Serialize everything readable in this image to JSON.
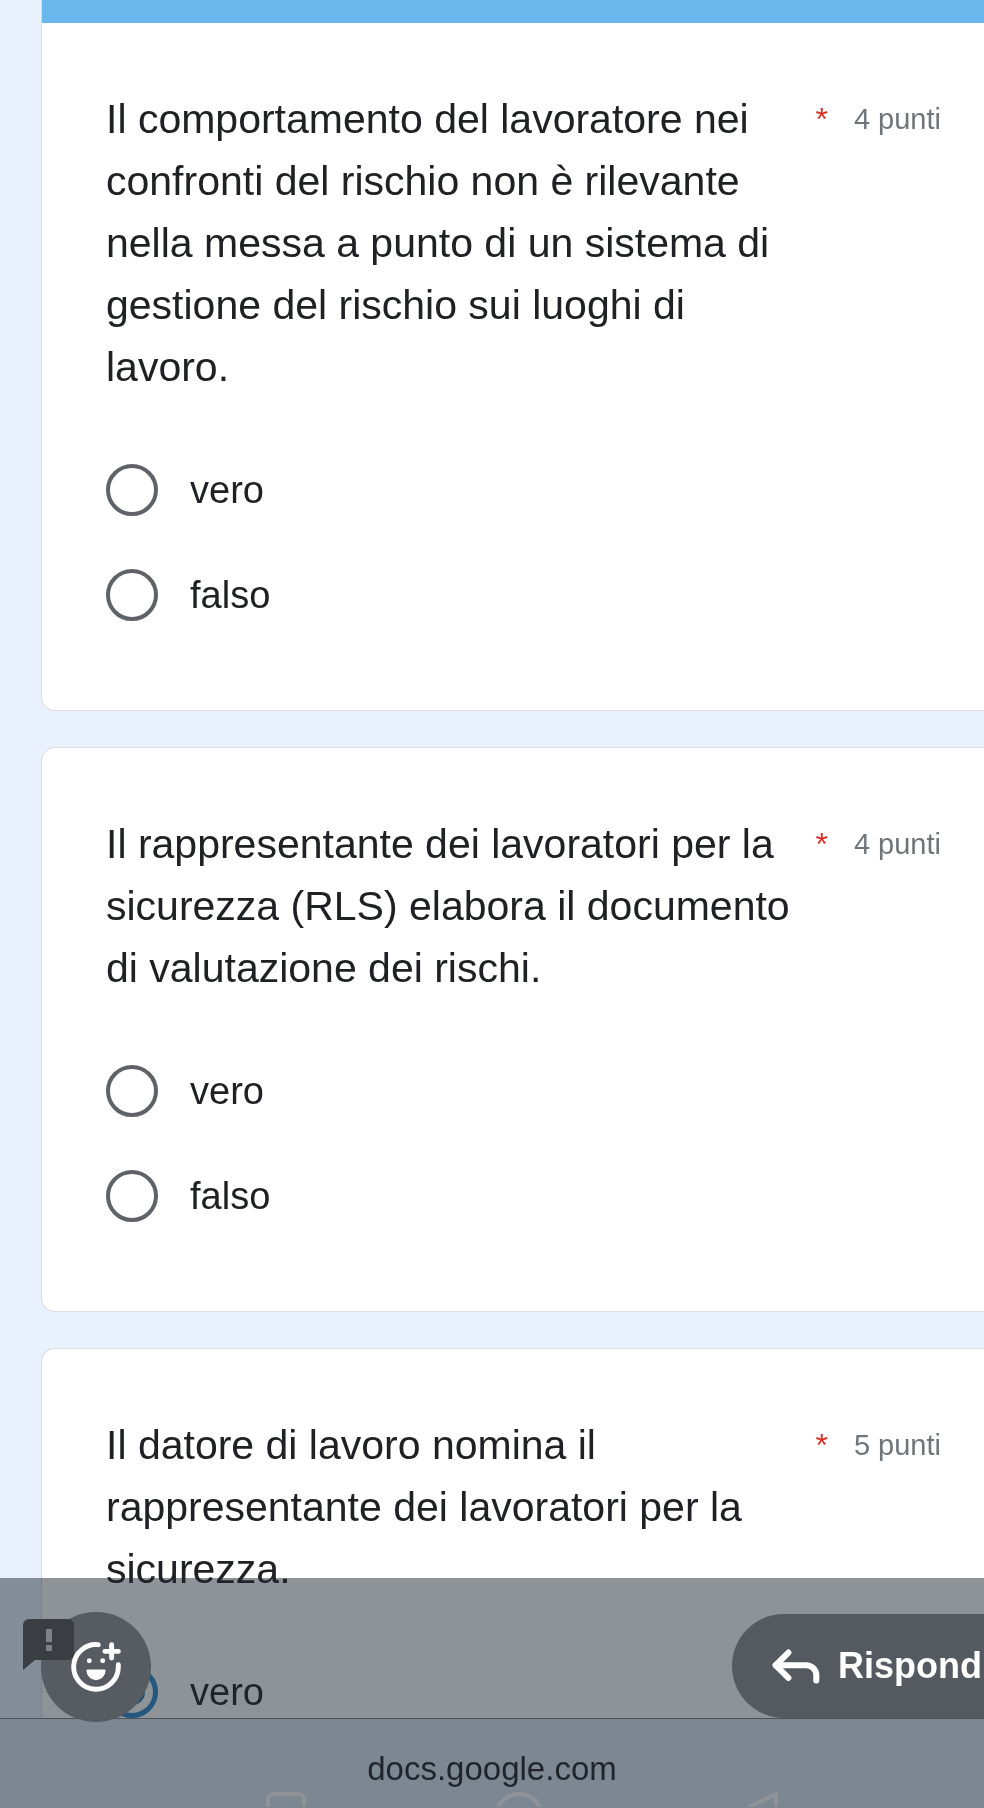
{
  "questions": [
    {
      "text": "Il comportamento del lavoratore nei confronti del rischio non è rilevante nella messa a punto di un sistema di gestione del rischio sui luoghi di lavoro.",
      "required_mark": "*",
      "points": "4 punti",
      "options": [
        {
          "label": "vero",
          "selected": false
        },
        {
          "label": "falso",
          "selected": false
        }
      ]
    },
    {
      "text": "Il rappresentante dei lavoratori per la sicurezza (RLS) elabora il documento di valutazione dei rischi.",
      "required_mark": "*",
      "points": "4 punti",
      "options": [
        {
          "label": "vero",
          "selected": false
        },
        {
          "label": "falso",
          "selected": false
        }
      ]
    },
    {
      "text": "Il datore di lavoro nomina il rappresentante dei lavoratori per la sicurezza.",
      "required_mark": "*",
      "points": "5 punti",
      "options": [
        {
          "label": "vero",
          "selected": true
        }
      ]
    }
  ],
  "reply_button": {
    "label": "Rispond"
  },
  "browser_bar": {
    "url": "docs.google.com"
  }
}
